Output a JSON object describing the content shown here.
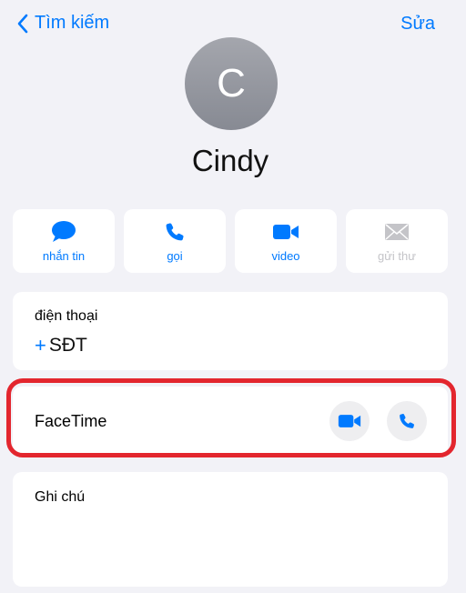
{
  "nav": {
    "back_label": "Tìm kiếm",
    "edit_label": "Sửa"
  },
  "contact": {
    "initial": "C",
    "name": "Cindy"
  },
  "actions": [
    {
      "id": "message",
      "label": "nhắn tin",
      "icon": "message-bubble-icon",
      "enabled": true
    },
    {
      "id": "call",
      "label": "gọi",
      "icon": "phone-icon",
      "enabled": true
    },
    {
      "id": "video",
      "label": "video",
      "icon": "video-camera-icon",
      "enabled": true
    },
    {
      "id": "mail",
      "label": "gửi thư",
      "icon": "envelope-icon",
      "enabled": false
    }
  ],
  "phone": {
    "label": "điện thoại",
    "prefix": "+",
    "value": "SĐT"
  },
  "facetime": {
    "label": "FaceTime",
    "video_icon": "video-camera-icon",
    "audio_icon": "phone-icon"
  },
  "notes": {
    "label": "Ghi chú"
  },
  "colors": {
    "accent": "#007aff",
    "highlight": "#e3262e",
    "background": "#f2f2f7",
    "disabled": "#c4c4c8"
  }
}
